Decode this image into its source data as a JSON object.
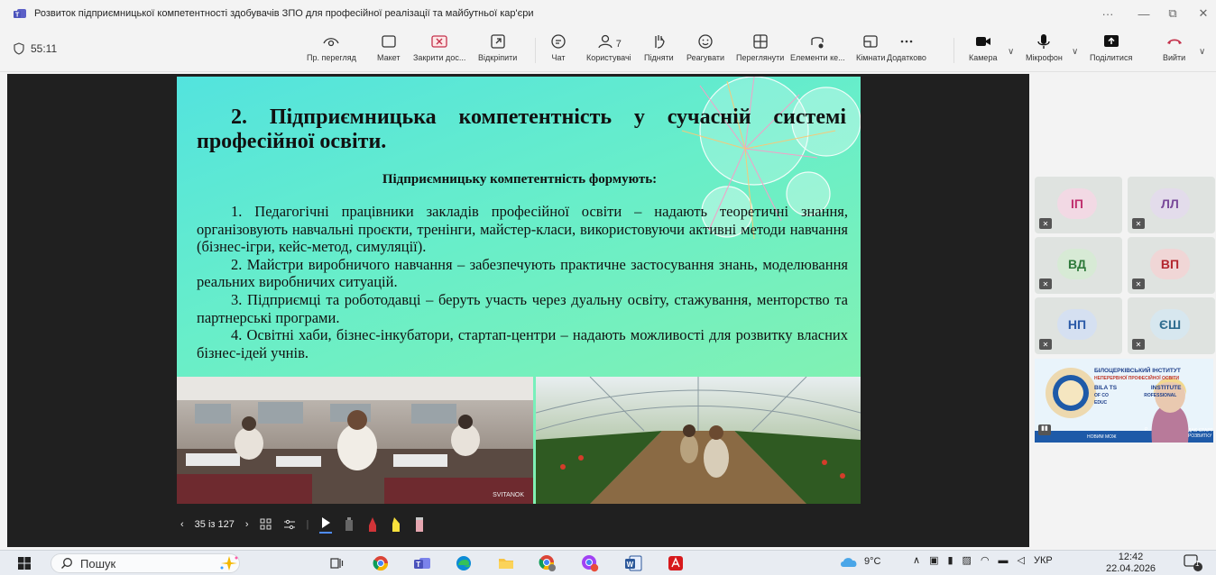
{
  "window": {
    "title": "Розвиток підприємницької компетентності здобувачів ЗПО для професійної реалізації та майбутньої кар'єри"
  },
  "toolbar": {
    "timer": "55:11",
    "items": [
      {
        "label": "Пр. перегляд",
        "icon": "eye-icon"
      },
      {
        "label": "Макет",
        "icon": "layout-icon"
      },
      {
        "label": "Закрити дос...",
        "icon": "close-share-icon"
      },
      {
        "label": "Відкріпити",
        "icon": "unpin-icon"
      },
      {
        "label": "Чат",
        "icon": "chat-icon"
      },
      {
        "label": "Користувачі",
        "icon": "people-icon"
      },
      {
        "label": "Підняти",
        "icon": "raise-hand-icon"
      },
      {
        "label": "Реагувати",
        "icon": "react-icon"
      },
      {
        "label": "Переглянути",
        "icon": "view-icon"
      },
      {
        "label": "Елементи ке...",
        "icon": "controls-icon"
      },
      {
        "label": "Кімнати",
        "icon": "rooms-icon"
      },
      {
        "label": "Додатково",
        "icon": "more-icon"
      },
      {
        "label": "Камера",
        "icon": "camera-icon"
      },
      {
        "label": "Мікрофон",
        "icon": "mic-icon"
      },
      {
        "label": "Поділитися",
        "icon": "share-icon"
      },
      {
        "label": "Вийти",
        "icon": "leave-icon"
      }
    ],
    "people_count": "7"
  },
  "slide": {
    "title": "2. Підприємницька компетентність у сучасній системі професійної освіти.",
    "subtitle": "Підприємницьку компетентність формують:",
    "points": [
      "1. Педагогічні працівники закладів професійної освіти – надають теоретичні знання, організовують навчальні проєкти, тренінги, майстер-класи, використовуючи активні методи навчання (бізнес-ігри, кейс-метод, симуляції).",
      "2. Майстри виробничого навчання – забезпечують практичне застосування знань, моделювання реальних виробничих ситуацій.",
      "3. Підприємці та роботодавці – беруть участь через дуальну освіту, стажування, менторство та партнерські програми.",
      "4. Освітні хаби, бізнес-інкубатори, стартап-центри – надають можливості для розвитку власних бізнес-ідей учнів."
    ],
    "watermark": "SVITANOK"
  },
  "slide_nav": {
    "counter": "35 із 127"
  },
  "participants": [
    {
      "initials": "ІП",
      "color": "#c0306e",
      "bg": "#f2d9e4"
    },
    {
      "initials": "ЛЛ",
      "color": "#7a4a9a",
      "bg": "#e3dceb"
    },
    {
      "initials": "ВД",
      "color": "#2f7a3b",
      "bg": "#d7ead5"
    },
    {
      "initials": "ВП",
      "color": "#b3262e",
      "bg": "#f0d6d6"
    },
    {
      "initials": "НП",
      "color": "#2b5aa8",
      "bg": "#d5e0f1"
    },
    {
      "initials": "ЄШ",
      "color": "#2e6c8f",
      "bg": "#d7e7ef"
    }
  ],
  "speaker_banner": {
    "line1": "БІЛОЦЕРКІВСЬКИЙ ІНСТИТУТ",
    "line2": "НЕПЕРЕРВНОЇ ПРОФЕСІЙНОЇ ОСВІТИ",
    "line3": "BILA TS",
    "line3b": "INSTITUTE",
    "line4": "OF CO",
    "line4b": "ROFESSIONAL",
    "line5": "EDUC",
    "footer_left": "НОВИМ МОЖ",
    "footer_right1": "ДАЄ СТАРТ",
    "footer_right2": "РОЗВИТКУ",
    "footer_mid": "Р"
  },
  "taskbar": {
    "search_placeholder": "Пошук",
    "weather": "9°C",
    "language": "УКР",
    "time": "12:42",
    "date": "22.04.2026",
    "notification_count": "1"
  }
}
